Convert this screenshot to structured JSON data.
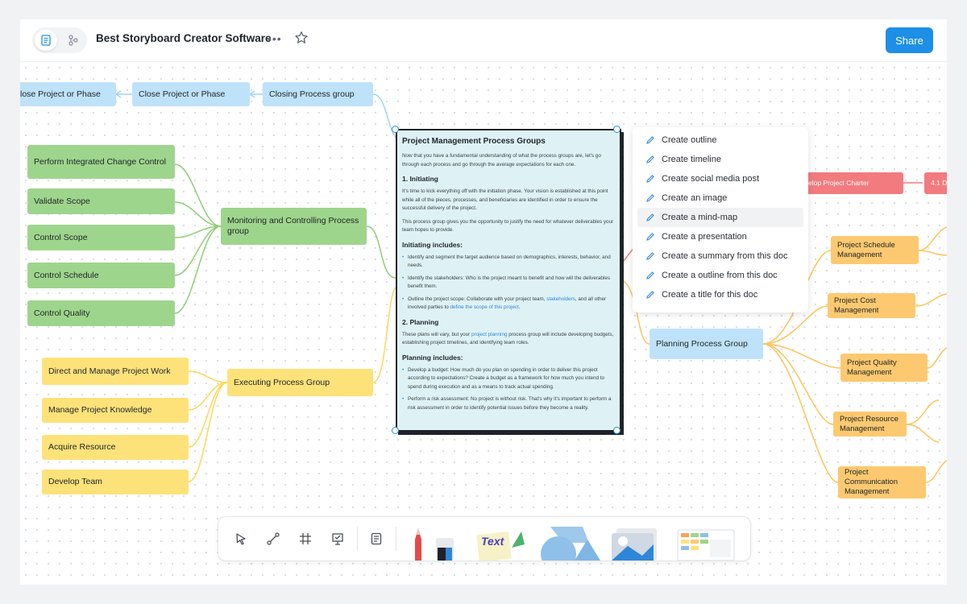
{
  "header": {
    "title": "Best Storyboard Creator Software",
    "more": "•••",
    "share_label": "Share"
  },
  "mindmap": {
    "closing": {
      "l2": "lose Project or Phase",
      "l1": "Close Project or Phase",
      "group": "Closing Process group"
    },
    "monitoring": {
      "group": "Monitoring and Controlling Process group",
      "items": [
        "Perform Integrated  Change Control",
        "Validate Scope",
        "Control Scope",
        "Control Schedule",
        "Control Quality"
      ]
    },
    "executing": {
      "group": "Executing Process Group",
      "items": [
        "Direct and Manage Project Work",
        "Manage Project Knowledge",
        "Acquire Resource",
        "Develop Team"
      ]
    },
    "planning": {
      "group": "Planning Process Group",
      "items": [
        "Project Schedule Management",
        "Project Cost Management",
        "Project Quality Management",
        "Project Resource Management",
        "Project Communication Management"
      ]
    },
    "initiating": {
      "item1": "elop Project Charter",
      "item2": "4.1 D"
    }
  },
  "document": {
    "title": "Project Management Process Groups",
    "intro": "Now that you have a fundamental understanding of what the process groups are, let's go through each process and go through the average expectations for each one.",
    "s1_title": "1. Initiating",
    "s1_p1": "It's time to kick everything off with the initiation phase. Your vision is established at this point while all of the pieces, processes, and beneficiaries are identified in order to ensure the successful delivery of the project.",
    "s1_p2": "This process group gives you the opportunity to justify the need for whatever deliverables your team hopes to provide.",
    "s1_sub": "Initiating includes:",
    "s1_b1": "Identify and segment the target audience based on demographics, interests, behavior, and needs.",
    "s1_b2": "Identify the stakeholders: Who is the project meant to benefit and how will the deliverables benefit them.",
    "s1_b3_a": "Outline the project scope: Collaborate with your project team, ",
    "s1_b3_link1": "stakeholders",
    "s1_b3_b": ", and all other involved parties to ",
    "s1_b3_link2": "define the scope of this project",
    "s1_b3_c": ".",
    "s2_title": "2. Planning",
    "s2_p1_a": "These plans will vary, but your ",
    "s2_p1_link": "project planning",
    "s2_p1_b": " process group will include developing budgets, establishing project timelines, and identifying team roles.",
    "s2_sub": "Planning includes:",
    "s2_b1": "Develop a budget: How much do you plan on spending in order to deliver this project according to expectations? Create a budget as a framework for how much you intend to spend during execution and as a means to track actual spending.",
    "s2_b2": "Perform a risk assessment: No project is without risk. That's why it's important to perform a risk assessment in order to identify potential issues before they become a reality."
  },
  "ai_menu": {
    "items": [
      "Create outline",
      "Create timeline",
      "Create social media post",
      "Create an image",
      "Create a mind-map",
      "Create a presentation",
      "Create a summary from this doc",
      "Create a outline from this doc",
      "Create a title for this doc"
    ],
    "hovered_index": 4
  },
  "toolbar": {
    "tools": [
      "select-tool",
      "connector-tool",
      "frame-tool",
      "presentation-tool",
      "document-tool"
    ],
    "assets": [
      "pen-marker-tool",
      "text-sticker-tool",
      "shapes-tool",
      "image-tool",
      "template-tool"
    ],
    "text_sticker_label": "Text"
  },
  "colors": {
    "accent": "#1d8fe6",
    "blue_node": "#bfe2fb",
    "green_node": "#9ed58c",
    "yellow_node": "#fde27a",
    "orange_node": "#fdc970",
    "red_node": "#f27b7f"
  }
}
